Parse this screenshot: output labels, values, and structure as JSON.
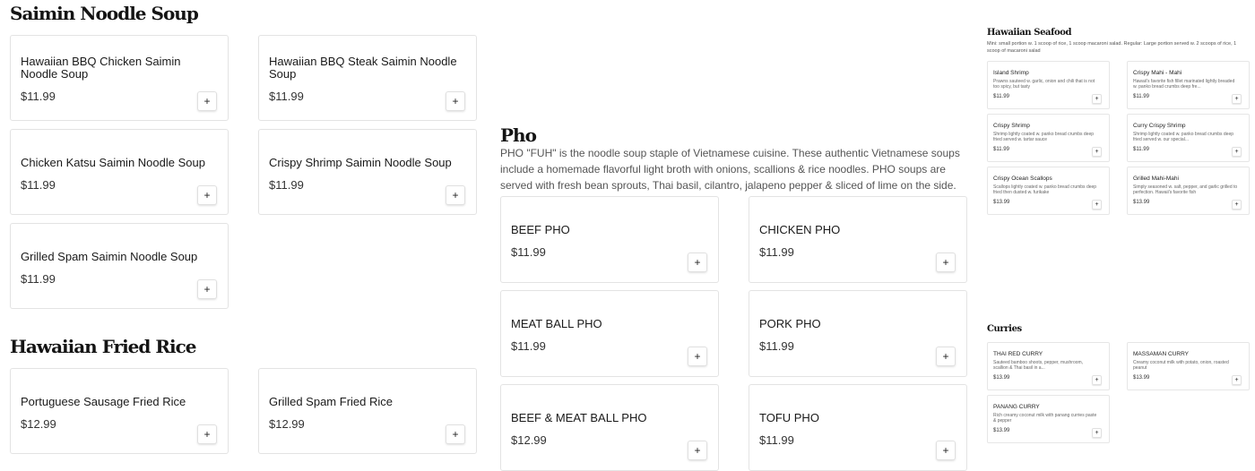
{
  "saimin": {
    "title": "Saimin Noodle Soup",
    "items": [
      {
        "name": "Hawaiian BBQ Chicken Saimin Noodle Soup",
        "price": "$11.99"
      },
      {
        "name": "Hawaiian BBQ Steak Saimin Noodle Soup",
        "price": "$11.99"
      },
      {
        "name": "Chicken Katsu Saimin Noodle Soup",
        "price": "$11.99"
      },
      {
        "name": "Crispy Shrimp Saimin Noodle Soup",
        "price": "$11.99"
      },
      {
        "name": "Grilled Spam Saimin Noodle Soup",
        "price": "$11.99"
      }
    ]
  },
  "fried_rice": {
    "title": "Hawaiian Fried Rice",
    "items": [
      {
        "name": "Portuguese Sausage Fried Rice",
        "price": "$12.99"
      },
      {
        "name": "Grilled Spam Fried Rice",
        "price": "$12.99"
      }
    ]
  },
  "pho": {
    "title": "Pho",
    "description": "PHO \"FUH\" is the noodle soup staple of Vietnamese cuisine. These authentic Vietnamese soups include a homemade flavorful light broth with onions, scallions & rice noodles. PHO soups are served with fresh bean sprouts, Thai basil, cilantro, jalapeno pepper & sliced of lime on the side.",
    "items": [
      {
        "name": "BEEF PHO",
        "price": "$11.99"
      },
      {
        "name": "CHICKEN PHO",
        "price": "$11.99"
      },
      {
        "name": "MEAT BALL PHO",
        "price": "$11.99"
      },
      {
        "name": "PORK PHO",
        "price": "$11.99"
      },
      {
        "name": "BEEF & MEAT BALL PHO",
        "price": "$12.99"
      },
      {
        "name": "TOFU PHO",
        "price": "$11.99"
      }
    ]
  },
  "seafood": {
    "title": "Hawaiian Seafood",
    "description": "Mini: small portion w. 1 scoop of rice, 1 scoop macaroni salad. Regular: Large portion served w. 2 scoops of rice, 1 scoop of macaroni salad",
    "items": [
      {
        "name": "Island Shrimp",
        "desc": "Prawns sauteed w. garlic, onion and chili that is not too spicy, but tasty",
        "price": "$11.99"
      },
      {
        "name": "Crispy Mahi - Mahi",
        "desc": "Hawaii's favorite fish fillet marinated lightly breaded w. panko bread crumbs deep fre...",
        "price": "$11.99"
      },
      {
        "name": "Crispy Shrimp",
        "desc": "Shrimp lightly coated w. panko bread crumbs deep fried served w. tartar sauce",
        "price": "$11.99"
      },
      {
        "name": "Curry Crispy Shrimp",
        "desc": "Shrimp lightly coated w. panko bread crumbs deep fried served w. our special...",
        "price": "$11.99"
      },
      {
        "name": "Crispy Ocean Scallops",
        "desc": "Scallops lightly coated w. panko bread crumbs deep fried then dusted w. furikake",
        "price": "$13.99"
      },
      {
        "name": "Grilled Mahi-Mahi",
        "desc": "Simply seasoned w. salt, pepper, and garlic grilled to perfection. Hawaii's favorite fish",
        "price": "$13.99"
      }
    ]
  },
  "curries": {
    "title": "Curries",
    "items": [
      {
        "name": "THAI RED CURRY",
        "desc": "Sauteed bamboo shoots, pepper, mushroom, scallion & Thai basil in a...",
        "price": "$13.99"
      },
      {
        "name": "MASSAMAN CURRY",
        "desc": "Creamy coconut milk with potato, onion, roasted peanut",
        "price": "$13.99"
      },
      {
        "name": "PANANG CURRY",
        "desc": "Rich creamy coconut milk with panang curries paste & pepper",
        "price": "$13.99"
      }
    ]
  },
  "add_label": "+",
  "icons": {
    "add": "plus-icon"
  }
}
